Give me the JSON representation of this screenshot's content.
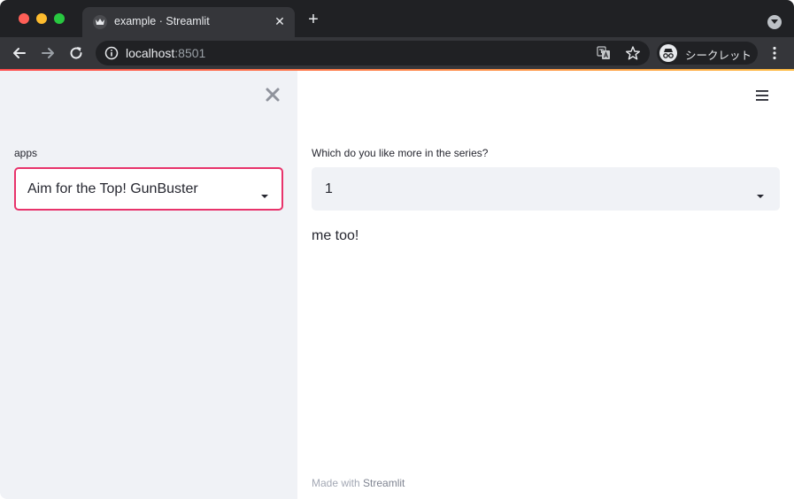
{
  "browser": {
    "tab_title": "example · Streamlit",
    "tab_close": "✕",
    "new_tab": "+",
    "url_host": "localhost",
    "url_port": ":8501",
    "incognito_label": "シークレット"
  },
  "sidebar": {
    "close_glyph": "✕",
    "select_label": "apps",
    "select_value": "Aim for the Top! GunBuster"
  },
  "main": {
    "select_label": "Which do you like more in the series?",
    "select_value": "1",
    "response": "me too!"
  },
  "footer": {
    "prefix": "Made with ",
    "brand": "Streamlit"
  },
  "colors": {
    "accent": "#e8336b",
    "sidebar_bg": "#f0f2f6",
    "text": "#262730",
    "chrome_dark": "#202124",
    "chrome_tab": "#35363a"
  },
  "icons": [
    "streamlit-crown-icon",
    "close-icon",
    "plus-icon",
    "back-arrow-icon",
    "forward-arrow-icon",
    "reload-icon",
    "info-icon",
    "translate-icon",
    "star-icon",
    "incognito-icon",
    "kebab-menu-icon",
    "hamburger-menu-icon",
    "caret-down-icon"
  ]
}
